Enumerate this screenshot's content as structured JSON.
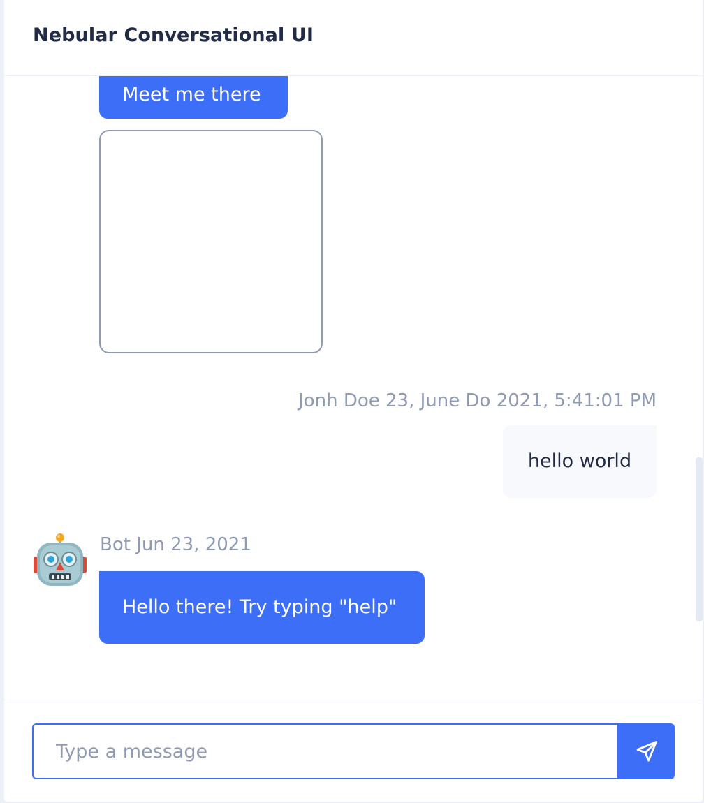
{
  "header": {
    "title": "Nebular Conversational UI"
  },
  "messages": [
    {
      "kind": "text",
      "sender": "bot",
      "text": "Meet me there"
    },
    {
      "kind": "map",
      "sender": "bot"
    },
    {
      "kind": "text",
      "sender": "user",
      "meta": "Jonh Doe 23, June Do 2021, 5:41:01 PM",
      "text": "hello world"
    },
    {
      "kind": "text",
      "sender": "bot",
      "avatar_icon": "robot-icon",
      "meta": "Bot Jun 23, 2021",
      "text": "Hello there! Try typing \"help\""
    }
  ],
  "composer": {
    "placeholder": "Type a message",
    "value": "",
    "send_icon": "send-icon"
  },
  "colors": {
    "primary": "#3d6ef7",
    "text": "#222b45",
    "hint": "#8f9bb3",
    "user_bubble": "#f7f9fc",
    "background": "#edf1f7"
  }
}
